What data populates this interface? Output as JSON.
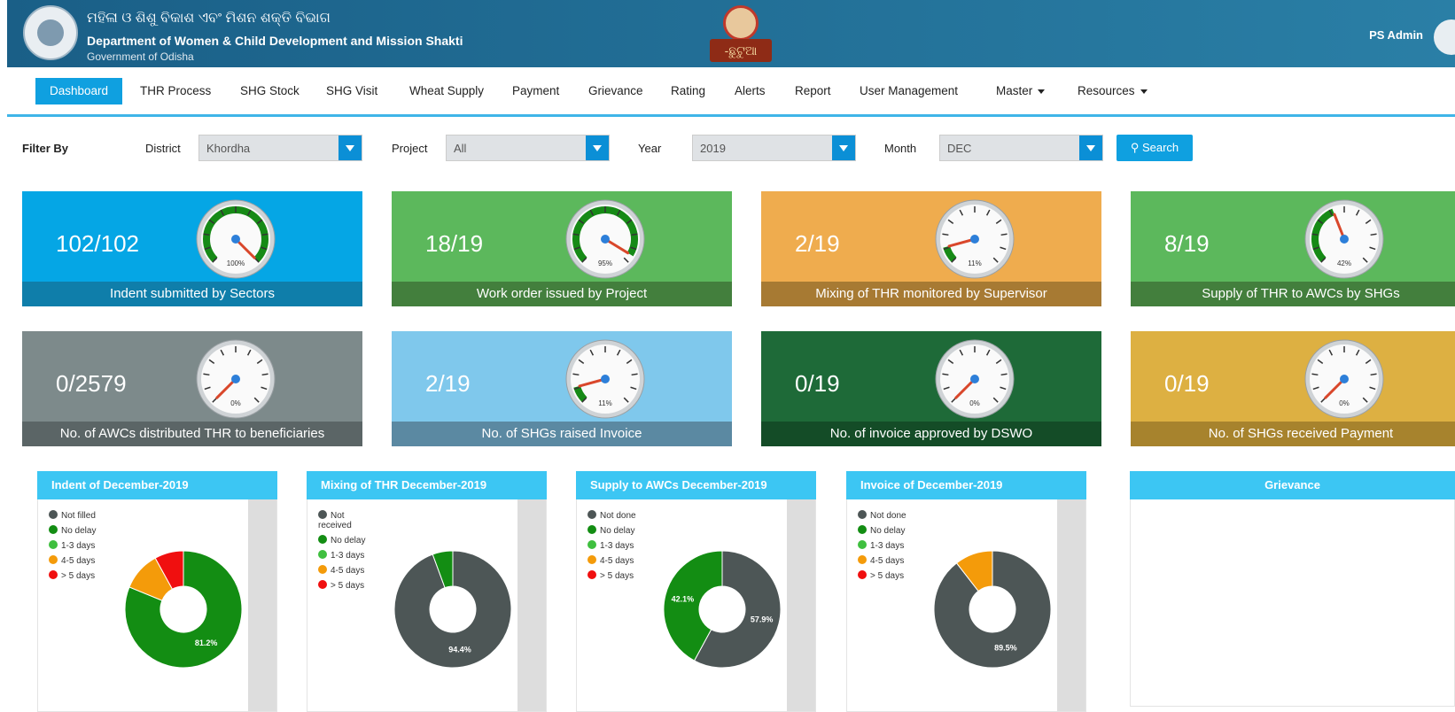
{
  "header": {
    "title_odia": "ମହିଳା ଓ ଶିଶୁ ବିକାଶ ଏବଂ ମିଶନ ଶକ୍ତି ବିଭାଗ",
    "title_dept": "Department of Women & Child Development and Mission Shakti",
    "title_gov": "Government of Odisha",
    "center_logo_text": "-ଛୁଟୁଆ",
    "user_name": "PS Admin"
  },
  "nav": {
    "items": [
      "Dashboard",
      "THR Process",
      "SHG Stock",
      "SHG Visit",
      "Wheat Supply",
      "Payment",
      "Grievance",
      "Rating",
      "Alerts",
      "Report",
      "User Management"
    ],
    "dropdowns": [
      "Master",
      "Resources"
    ],
    "active": "Dashboard"
  },
  "filter": {
    "label": "Filter By",
    "district_label": "District",
    "district_value": "Khordha",
    "project_label": "Project",
    "project_value": "All",
    "year_label": "Year",
    "year_value": "2019",
    "month_label": "Month",
    "month_value": "DEC",
    "search_label": "Search"
  },
  "cards": [
    {
      "value": "102/102",
      "caption": "Indent submitted by Sectors",
      "pct": 100,
      "pct_label": "100%",
      "bg": "#05a6e5",
      "cap_bg": "#0f7eaa",
      "arc": "#168a16"
    },
    {
      "value": "18/19",
      "caption": "Work order issued by Project",
      "pct": 95,
      "pct_label": "95%",
      "bg": "#5cb85c",
      "cap_bg": "#437f3d",
      "arc": "#168a16"
    },
    {
      "value": "2/19",
      "caption": "Mixing of THR monitored by Supervisor",
      "pct": 11,
      "pct_label": "11%",
      "bg": "#efac4e",
      "cap_bg": "#a77a33",
      "arc": "#168a16"
    },
    {
      "value": "8/19",
      "caption": "Supply of THR to AWCs by SHGs",
      "pct": 42,
      "pct_label": "42%",
      "bg": "#5cb85c",
      "cap_bg": "#437f3d",
      "arc": "#168a16"
    },
    {
      "value": "0/2579",
      "caption": "No. of AWCs distributed THR to beneficiaries",
      "pct": 0,
      "pct_label": "0%",
      "bg": "#7d8a8b",
      "cap_bg": "#5b6566",
      "arc": "#168a16"
    },
    {
      "value": "2/19",
      "caption": "No. of SHGs raised Invoice",
      "pct": 11,
      "pct_label": "11%",
      "bg": "#7fc8ec",
      "cap_bg": "#5b89a2",
      "arc": "#168a16"
    },
    {
      "value": "0/19",
      "caption": "No. of invoice approved by DSWO",
      "pct": 0,
      "pct_label": "0%",
      "bg": "#1e6a38",
      "cap_bg": "#144c27",
      "arc": "#168a16"
    },
    {
      "value": "0/19",
      "caption": "No. of SHGs received Payment",
      "pct": 0,
      "pct_label": "0%",
      "bg": "#ddb042",
      "cap_bg": "#a7832d",
      "arc": "#168a16"
    }
  ],
  "colors": {
    "not_filled": "#4d5656",
    "no_delay": "#138d13",
    "d13": "#3fbf3f",
    "d45": "#f49b0a",
    "d5": "#f00f0f"
  },
  "chart_data": [
    {
      "type": "pie",
      "title": "Indent of December-2019",
      "labels": [
        "Not filled",
        "No delay",
        "1-3 days",
        "4-5 days",
        "> 5 days"
      ],
      "values": [
        0,
        81.2,
        0,
        10.8,
        8.0
      ],
      "data_labels": [
        "",
        "81.2%",
        "",
        "",
        ""
      ]
    },
    {
      "type": "pie",
      "title": "Mixing of THR December-2019",
      "labels": [
        "Not received",
        "No delay",
        "1-3 days",
        "4-5 days",
        "> 5 days"
      ],
      "values": [
        94.4,
        5.6,
        0,
        0,
        0
      ],
      "data_labels": [
        "94.4%",
        "",
        "",
        "",
        ""
      ]
    },
    {
      "type": "pie",
      "title": "Supply to AWCs December-2019",
      "labels": [
        "Not done",
        "No delay",
        "1-3 days",
        "4-5 days",
        "> 5 days"
      ],
      "values": [
        57.9,
        42.1,
        0,
        0,
        0
      ],
      "data_labels": [
        "57.9%",
        "42.1%",
        "",
        "",
        ""
      ]
    },
    {
      "type": "pie",
      "title": "Invoice of December-2019",
      "labels": [
        "Not done",
        "No delay",
        "1-3 days",
        "4-5 days",
        "> 5 days"
      ],
      "values": [
        89.5,
        0,
        0,
        10.5,
        0
      ],
      "data_labels": [
        "89.5%",
        "",
        "",
        "",
        ""
      ]
    }
  ],
  "grievance": {
    "title": "Grievance"
  }
}
